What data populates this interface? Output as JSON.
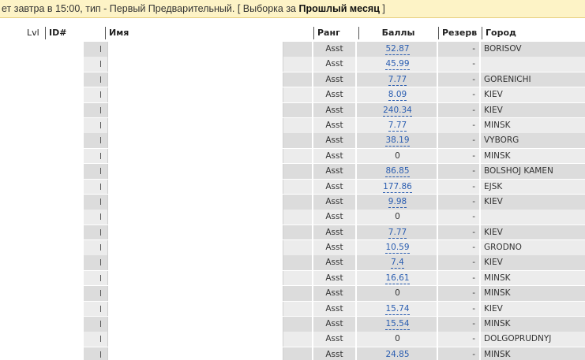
{
  "banner": {
    "text_before": "ет завтра в 15:00, тип - Первый Предварительный. [ Выборка за ",
    "bold": "Прошлый месяц",
    "text_after": " ]"
  },
  "columns": {
    "lvl": "Lvl",
    "id": "ID#",
    "name": "Имя",
    "rank": "Ранг",
    "score": "Баллы",
    "reserve": "Резерв",
    "city": "Город"
  },
  "rows": [
    {
      "rank": "Asst",
      "score": "52.87",
      "link": true,
      "reserve": "-",
      "city": "BORISOV"
    },
    {
      "rank": "Asst",
      "score": "45.99",
      "link": true,
      "reserve": "-",
      "city": ""
    },
    {
      "rank": "Asst",
      "score": "7.77",
      "link": true,
      "reserve": "-",
      "city": "GORENICHI"
    },
    {
      "rank": "Asst",
      "score": "8.09",
      "link": true,
      "reserve": "-",
      "city": "KIEV"
    },
    {
      "rank": "Asst",
      "score": "240.34",
      "link": true,
      "reserve": "-",
      "city": "KIEV"
    },
    {
      "rank": "Asst",
      "score": "7.77",
      "link": true,
      "reserve": "-",
      "city": "MINSK"
    },
    {
      "rank": "Asst",
      "score": "38.19",
      "link": true,
      "reserve": "-",
      "city": "VYBORG"
    },
    {
      "rank": "Asst",
      "score": "0",
      "link": false,
      "reserve": "-",
      "city": "MINSK"
    },
    {
      "rank": "Asst",
      "score": "86.85",
      "link": true,
      "reserve": "-",
      "city": "BOLSHOJ KAMEN"
    },
    {
      "rank": "Asst",
      "score": "177.86",
      "link": true,
      "reserve": "-",
      "city": "EJSK"
    },
    {
      "rank": "Asst",
      "score": "9.98",
      "link": true,
      "reserve": "-",
      "city": "KIEV"
    },
    {
      "rank": "Asst",
      "score": "0",
      "link": false,
      "reserve": "-",
      "city": ""
    },
    {
      "rank": "Asst",
      "score": "7.77",
      "link": true,
      "reserve": "-",
      "city": "KIEV"
    },
    {
      "rank": "Asst",
      "score": "10.59",
      "link": true,
      "reserve": "-",
      "city": "GRODNO"
    },
    {
      "rank": "Asst",
      "score": "7.4",
      "link": true,
      "reserve": "-",
      "city": "KIEV"
    },
    {
      "rank": "Asst",
      "score": "16.61",
      "link": true,
      "reserve": "-",
      "city": "MINSK"
    },
    {
      "rank": "Asst",
      "score": "0",
      "link": false,
      "reserve": "-",
      "city": "MINSK"
    },
    {
      "rank": "Asst",
      "score": "15.74",
      "link": true,
      "reserve": "-",
      "city": "KIEV"
    },
    {
      "rank": "Asst",
      "score": "15.54",
      "link": true,
      "reserve": "-",
      "city": "MINSK"
    },
    {
      "rank": "Asst",
      "score": "0",
      "link": false,
      "reserve": "-",
      "city": "DOLGOPRUDNYJ"
    },
    {
      "rank": "Asst",
      "score": "24.85",
      "link": true,
      "reserve": "-",
      "city": "MINSK"
    }
  ]
}
